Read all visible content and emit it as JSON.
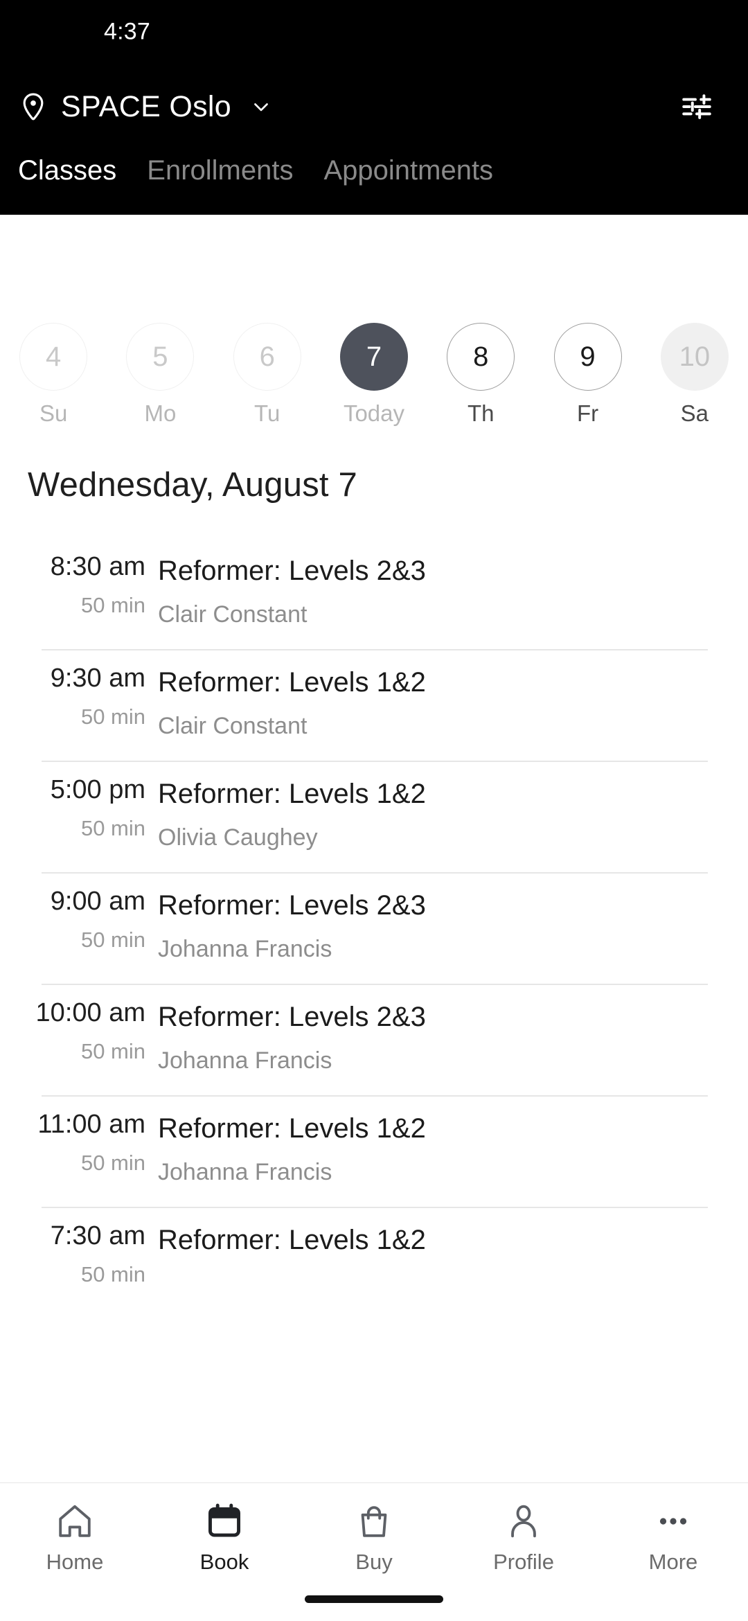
{
  "status_bar": {
    "time": "4:37"
  },
  "app_bar": {
    "location_icon": "map-pin-icon",
    "venue": "SPACE Oslo",
    "chevron_icon": "chevron-down-icon",
    "filter_icon": "filter-sliders-icon"
  },
  "tabs": [
    {
      "label": "Classes",
      "active": true
    },
    {
      "label": "Enrollments",
      "active": false
    },
    {
      "label": "Appointments",
      "active": false
    }
  ],
  "date_strip": [
    {
      "day": "4",
      "weekday": "Su",
      "state": "past"
    },
    {
      "day": "5",
      "weekday": "Mo",
      "state": "past"
    },
    {
      "day": "6",
      "weekday": "Tu",
      "state": "past"
    },
    {
      "day": "7",
      "weekday": "Today",
      "state": "today"
    },
    {
      "day": "8",
      "weekday": "Th",
      "state": "future"
    },
    {
      "day": "9",
      "weekday": "Fr",
      "state": "future"
    },
    {
      "day": "10",
      "weekday": "Sa",
      "state": "muted"
    }
  ],
  "date_heading": "Wednesday, August 7",
  "classes": [
    {
      "time": "8:30 am",
      "duration": "50 min",
      "title": "Reformer: Levels 2&3",
      "instructor": "Clair Constant"
    },
    {
      "time": "9:30 am",
      "duration": "50 min",
      "title": "Reformer: Levels 1&2",
      "instructor": "Clair Constant"
    },
    {
      "time": "5:00 pm",
      "duration": "50 min",
      "title": "Reformer: Levels 1&2",
      "instructor": "Olivia Caughey"
    },
    {
      "time": "9:00 am",
      "duration": "50 min",
      "title": "Reformer: Levels 2&3",
      "instructor": "Johanna Francis"
    },
    {
      "time": "10:00 am",
      "duration": "50 min",
      "title": "Reformer: Levels 2&3",
      "instructor": "Johanna Francis"
    },
    {
      "time": "11:00 am",
      "duration": "50 min",
      "title": "Reformer: Levels 1&2",
      "instructor": "Johanna Francis"
    },
    {
      "time": "7:30 am",
      "duration": "50 min",
      "title": "Reformer: Levels 1&2",
      "instructor": ""
    }
  ],
  "bottom_nav": [
    {
      "label": "Home",
      "icon": "home-icon",
      "active": false
    },
    {
      "label": "Book",
      "icon": "calendar-icon",
      "active": true
    },
    {
      "label": "Buy",
      "icon": "bag-icon",
      "active": false
    },
    {
      "label": "Profile",
      "icon": "person-icon",
      "active": false
    },
    {
      "label": "More",
      "icon": "more-dots-icon",
      "active": false
    }
  ],
  "colors": {
    "header_bg": "#000000",
    "selected_day": "#4e525c",
    "muted_text": "#8d8d8d",
    "divider": "#e6e6e6"
  }
}
